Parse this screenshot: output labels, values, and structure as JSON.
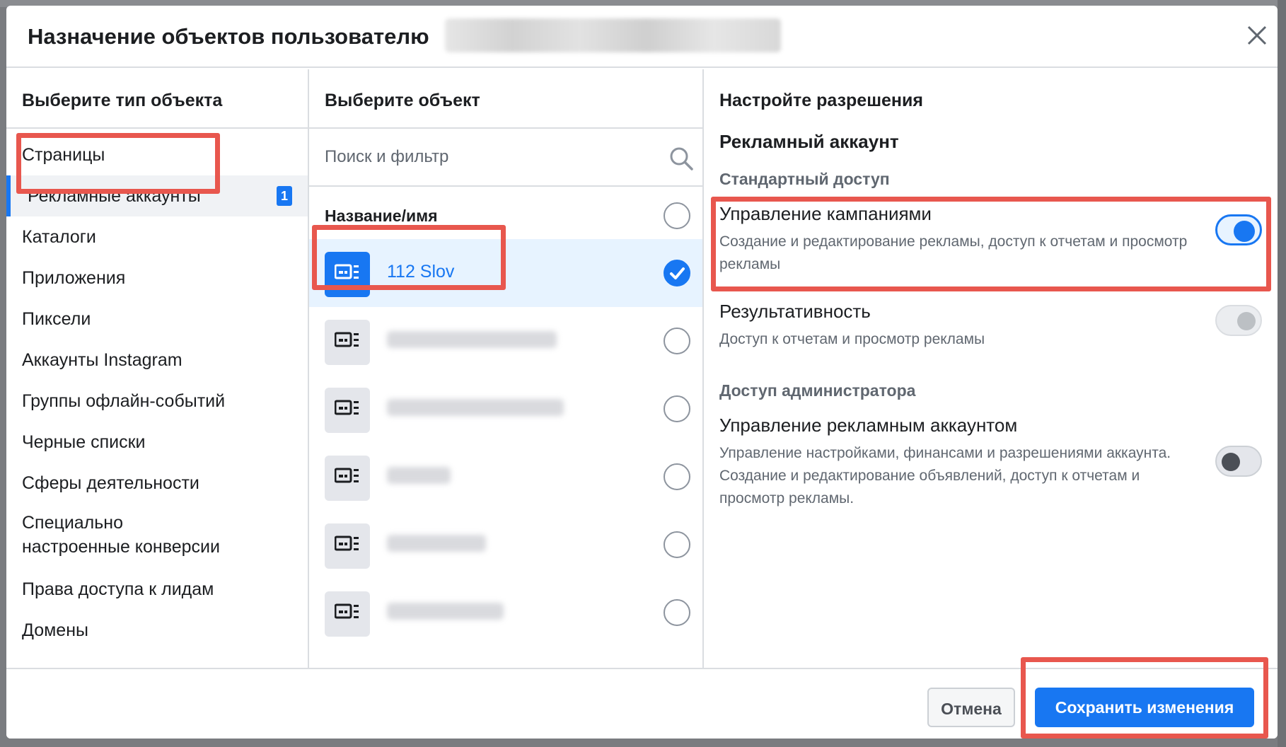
{
  "dialog": {
    "title": "Назначение объектов пользователю"
  },
  "object_types": {
    "heading": "Выберите тип объекта",
    "items": [
      {
        "label": "Страницы"
      },
      {
        "label": "Рекламные аккаунты",
        "count": "1",
        "active": true
      },
      {
        "label": "Каталоги"
      },
      {
        "label": "Приложения"
      },
      {
        "label": "Пиксели"
      },
      {
        "label": "Аккаунты Instagram"
      },
      {
        "label": "Группы офлайн-событий"
      },
      {
        "label": "Черные списки"
      },
      {
        "label": "Сферы деятельности"
      },
      {
        "label": "Специально настроенные конверсии"
      },
      {
        "label": "Права доступа к лидам"
      },
      {
        "label": "Домены"
      }
    ]
  },
  "objects": {
    "heading": "Выберите объект",
    "search_placeholder": "Поиск и фильтр",
    "column_header": "Название/имя",
    "items": [
      {
        "name": "112 Slov",
        "selected": true
      }
    ]
  },
  "permissions": {
    "heading": "Настройте разрешения",
    "account_type": "Рекламный аккаунт",
    "standard_label": "Стандартный доступ",
    "manage_campaigns": {
      "title": "Управление кампаниями",
      "desc": "Создание и редактирование рекламы, доступ к отчетам и просмотр рекламы",
      "enabled": true
    },
    "performance": {
      "title": "Результативность",
      "desc": "Доступ к отчетам и просмотр рекламы",
      "enabled": true
    },
    "admin_label": "Доступ администратора",
    "manage_account": {
      "title": "Управление рекламным аккаунтом",
      "desc": "Управление настройками, финансами и разрешениями аккаунта. Создание и редактирование объявлений, доступ к отчетам и просмотр рекламы.",
      "enabled": false
    }
  },
  "footer": {
    "cancel_label": "Отмена",
    "save_label": "Сохранить изменения"
  },
  "colors": {
    "accent": "#1877f2",
    "highlight": "#e8574e"
  }
}
